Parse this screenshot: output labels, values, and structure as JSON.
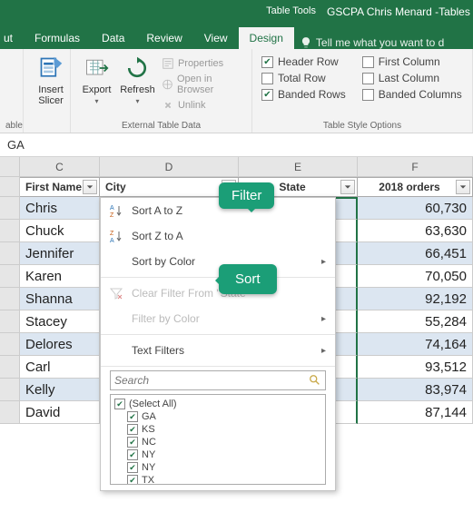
{
  "titlebar": {
    "table_tools": "Table Tools",
    "doc_title": "GSCPA Chris Menard -Tables"
  },
  "tabs": {
    "t0": "ut",
    "t1": "Formulas",
    "t2": "Data",
    "t3": "Review",
    "t4": "View",
    "t5": "Design",
    "tell_me": "Tell me what you want to d"
  },
  "ribbon": {
    "table_label": "able",
    "insert_slicer": "Insert\nSlicer",
    "export": "Export",
    "refresh": "Refresh",
    "properties": "Properties",
    "open_browser": "Open in Browser",
    "unlink": "Unlink",
    "ext_data": "External Table Data",
    "header_row": "Header Row",
    "total_row": "Total Row",
    "banded_rows": "Banded Rows",
    "first_col": "First Column",
    "last_col": "Last Column",
    "banded_cols": "Banded Columns",
    "style_opts": "Table Style Options"
  },
  "formula": {
    "value": "GA"
  },
  "cols": {
    "C": "C",
    "D": "D",
    "E": "E",
    "F": "F"
  },
  "headers": {
    "first_name": "First Name",
    "city": "City",
    "state": "State",
    "orders": "2018 orders"
  },
  "rows": [
    {
      "first": "Chris",
      "orders": "60,730"
    },
    {
      "first": "Chuck",
      "orders": "63,630"
    },
    {
      "first": "Jennifer",
      "orders": "66,451"
    },
    {
      "first": "Karen",
      "orders": "70,050"
    },
    {
      "first": "Shanna",
      "orders": "92,192"
    },
    {
      "first": "Stacey",
      "orders": "55,284"
    },
    {
      "first": "Delores",
      "orders": "74,164"
    },
    {
      "first": "Carl",
      "orders": "93,512"
    },
    {
      "first": "Kelly",
      "orders": "83,974"
    },
    {
      "first": "David",
      "orders": "87,144"
    }
  ],
  "menu": {
    "sort_az": "Sort A to Z",
    "sort_za": "Sort Z to A",
    "sort_color": "Sort by Color",
    "clear_filter": "Clear Filter From \"State\"",
    "filter_color": "Filter by Color",
    "text_filters": "Text Filters",
    "search_ph": "Search",
    "select_all": "(Select All)",
    "items": [
      "GA",
      "KS",
      "NC",
      "NY",
      "NY",
      "TX"
    ]
  },
  "callouts": {
    "filter": "Filter",
    "sort": "Sort"
  }
}
